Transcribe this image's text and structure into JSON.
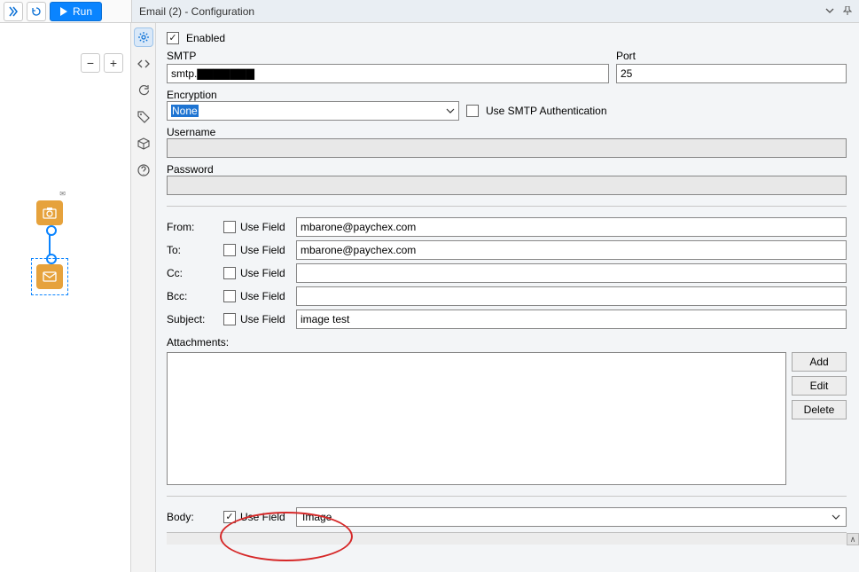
{
  "toolbar": {
    "run_label": "Run"
  },
  "panel": {
    "title": "Email (2) - Configuration"
  },
  "config": {
    "enabled_label": "Enabled",
    "enabled_checked": true,
    "smtp_label": "SMTP",
    "smtp_value": "smtp.▇▇▇▇▇▇▇",
    "port_label": "Port",
    "port_value": "25",
    "encryption_label": "Encryption",
    "encryption_value": "None",
    "use_smtp_auth_label": "Use SMTP Authentication",
    "use_smtp_auth_checked": false,
    "username_label": "Username",
    "username_value": "",
    "password_label": "Password",
    "password_value": "",
    "use_field_label": "Use Field",
    "from": {
      "label": "From:",
      "use_field": false,
      "value": "mbarone@paychex.com"
    },
    "to": {
      "label": "To:",
      "use_field": false,
      "value": "mbarone@paychex.com"
    },
    "cc": {
      "label": "Cc:",
      "use_field": false,
      "value": ""
    },
    "bcc": {
      "label": "Bcc:",
      "use_field": false,
      "value": ""
    },
    "subject": {
      "label": "Subject:",
      "use_field": false,
      "value": "image test"
    },
    "attachments_label": "Attachments:",
    "attach_buttons": {
      "add": "Add",
      "edit": "Edit",
      "delete": "Delete"
    },
    "body_label": "Body:",
    "body_use_field": true,
    "body_value": "Image"
  },
  "side_tabs": [
    "configuration",
    "code",
    "refresh",
    "tags",
    "package",
    "help"
  ]
}
